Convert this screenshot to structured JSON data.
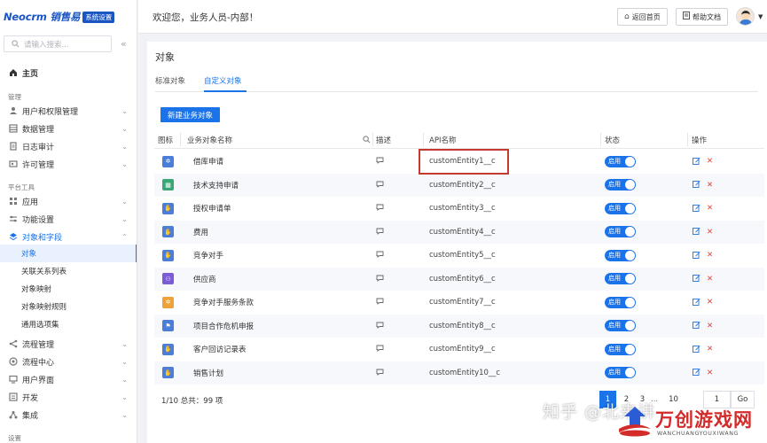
{
  "brand": {
    "logo": "Neocrm 销售易",
    "badge": "系统设置"
  },
  "search": {
    "placeholder": "请输入搜索..."
  },
  "collapse_icon": "double-chevron-left",
  "sidebar": {
    "home": "主页",
    "section_manage": "管理",
    "manage_items": [
      "用户和权限管理",
      "数据管理",
      "日志审计",
      "许可管理"
    ],
    "section_platform": "平台工具",
    "platform_items": [
      "应用",
      "功能设置",
      "对象和字段"
    ],
    "sub_items": [
      "对象",
      "关联关系列表",
      "对象映射",
      "对象映射规则",
      "通用选项集"
    ],
    "more_items": [
      "流程管理",
      "流程中心",
      "用户界面",
      "开发",
      "集成"
    ],
    "section_settings": "设置"
  },
  "header": {
    "welcome": "欢迎您，业务人员-内部！",
    "home_button": "返回首页",
    "help_button": "帮助文档"
  },
  "main": {
    "title": "对象",
    "tabs": [
      "标准对象",
      "自定义对象"
    ],
    "active_tab": "自定义对象",
    "new_button": "新建业务对象"
  },
  "table": {
    "columns": [
      "图标",
      "业务对象名称",
      "描述",
      "API名称",
      "状态",
      "操作"
    ],
    "rows": [
      {
        "name": "借库申请",
        "api": "customEntity1__c",
        "status": "启用",
        "icon_color": "#4a7ed9",
        "icon": "gear"
      },
      {
        "name": "技术支持申请",
        "api": "customEntity2__c",
        "status": "启用",
        "icon_color": "#3aa776",
        "icon": "grid"
      },
      {
        "name": "授权申请单",
        "api": "customEntity3__c",
        "status": "启用",
        "icon_color": "#4a7ed9",
        "icon": "thumb"
      },
      {
        "name": "费用",
        "api": "customEntity4__c",
        "status": "启用",
        "icon_color": "#4a7ed9",
        "icon": "thumb"
      },
      {
        "name": "竞争对手",
        "api": "customEntity5__c",
        "status": "启用",
        "icon_color": "#4a7ed9",
        "icon": "thumb"
      },
      {
        "name": "供应商",
        "api": "customEntity6__c",
        "status": "启用",
        "icon_color": "#7b5bd6",
        "icon": "people"
      },
      {
        "name": "竞争对手服务条款",
        "api": "customEntity7__c",
        "status": "启用",
        "icon_color": "#f0a23a",
        "icon": "gear"
      },
      {
        "name": "项目合作危机申报",
        "api": "customEntity8__c",
        "status": "启用",
        "icon_color": "#4a7ed9",
        "icon": "flag"
      },
      {
        "name": "客户回访记录表",
        "api": "customEntity9__c",
        "status": "启用",
        "icon_color": "#4a7ed9",
        "icon": "thumb"
      },
      {
        "name": "销售计划",
        "api": "customEntity10__c",
        "status": "启用",
        "icon_color": "#4a7ed9",
        "icon": "thumb"
      }
    ]
  },
  "pagination": {
    "summary": "1/10 总共：99 项",
    "pages": [
      "1",
      "2",
      "3",
      "...",
      "10"
    ],
    "current": "1",
    "input_value": "1",
    "go_label": "Go"
  },
  "watermark": {
    "zhihu": "知乎 @北来讲",
    "title": "万创游戏网",
    "subtitle": "WANCHUANGYOUXIWANG"
  },
  "colors": {
    "accent": "#1a73e8",
    "brand": "#1a55c4",
    "delete": "#e03e3e",
    "highlight": "#c43a2e"
  }
}
